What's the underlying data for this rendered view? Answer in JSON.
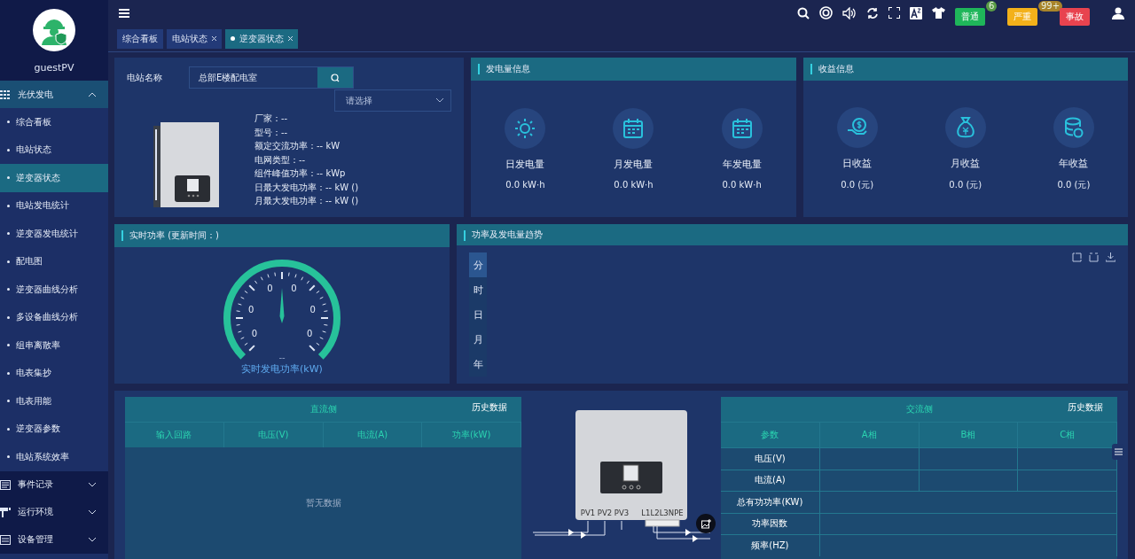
{
  "sidebar": {
    "user": "guestPV",
    "menu": [
      {
        "label": "光伏发电",
        "expanded": true,
        "children": [
          {
            "label": "综合看板",
            "selected": false
          },
          {
            "label": "电站状态",
            "selected": false
          },
          {
            "label": "逆变器状态",
            "selected": true
          },
          {
            "label": "电站发电统计",
            "selected": false
          },
          {
            "label": "逆变器发电统计",
            "selected": false
          },
          {
            "label": "配电图",
            "selected": false
          },
          {
            "label": "逆变器曲线分析",
            "selected": false
          },
          {
            "label": "多设备曲线分析",
            "selected": false
          },
          {
            "label": "组串离散率",
            "selected": false
          },
          {
            "label": "电表集抄",
            "selected": false
          },
          {
            "label": "电表用能",
            "selected": false
          },
          {
            "label": "逆变器参数",
            "selected": false
          },
          {
            "label": "电站系统效率",
            "selected": false
          }
        ]
      },
      {
        "label": "事件记录",
        "expanded": false
      },
      {
        "label": "运行环境",
        "expanded": false
      },
      {
        "label": "设备管理",
        "expanded": false
      }
    ]
  },
  "header": {
    "badges": [
      {
        "label": "普通",
        "count": "6",
        "color": "#1fb65a"
      },
      {
        "label": "严重",
        "count": "99+",
        "color": "#f3b11a"
      },
      {
        "label": "事故",
        "color": "#e8434f"
      }
    ]
  },
  "tabs": [
    {
      "label": "综合看板",
      "closable": false,
      "selected": false
    },
    {
      "label": "电站状态",
      "closable": true,
      "selected": false
    },
    {
      "label": "逆变器状态",
      "closable": true,
      "selected": true
    }
  ],
  "station": {
    "label": "电站名称",
    "value": "总部E楼配电室",
    "select_placeholder": "请选择",
    "info": [
      "厂家：--",
      "型号：--",
      "额定交流功率：-- kW",
      "电网类型：--",
      "组件峰值功率：-- kWp",
      "日最大发电功率：-- kW ()",
      "月最大发电功率：-- kW ()"
    ]
  },
  "generation": {
    "title": "发电量信息",
    "items": [
      {
        "label": "日发电量",
        "value": "0.0 kW·h"
      },
      {
        "label": "月发电量",
        "value": "0.0 kW·h"
      },
      {
        "label": "年发电量",
        "value": "0.0 kW·h"
      }
    ]
  },
  "income": {
    "title": "收益信息",
    "items": [
      {
        "label": "日收益",
        "value": "0.0 (元)"
      },
      {
        "label": "月收益",
        "value": "0.0 (元)"
      },
      {
        "label": "年收益",
        "value": "0.0 (元)"
      }
    ]
  },
  "realtime": {
    "title": "实时功率 (更新时间：)",
    "scale_labels": [
      "0",
      "0",
      "0",
      "0",
      "0",
      "0"
    ],
    "reading": "--",
    "caption": "实时发电功率(kW)"
  },
  "trend": {
    "title": "功率及发电量趋势",
    "periods": [
      {
        "label": "分",
        "selected": true
      },
      {
        "label": "时",
        "selected": false
      },
      {
        "label": "日",
        "selected": false
      },
      {
        "label": "月",
        "selected": false
      },
      {
        "label": "年",
        "selected": false
      }
    ]
  },
  "dc": {
    "title": "直流侧",
    "history": "历史数据",
    "columns": [
      "输入回路",
      "电压(V)",
      "电流(A)",
      "功率(kW)"
    ],
    "empty": "暂无数据"
  },
  "diagram": {
    "pv_labels": [
      "PV1",
      "PV2",
      "PV3"
    ],
    "ac_label": "L1L2L3NPE"
  },
  "ac": {
    "title": "交流侧",
    "history": "历史数据",
    "columns": [
      "参数",
      "A相",
      "B相",
      "C相"
    ],
    "rows": [
      {
        "label": "电压(V)",
        "kind": "phase"
      },
      {
        "label": "电流(A)",
        "kind": "phase"
      },
      {
        "label": "总有功功率(KW)",
        "kind": "total"
      },
      {
        "label": "功率因数",
        "kind": "total"
      },
      {
        "label": "频率(HZ)",
        "kind": "total"
      }
    ]
  }
}
